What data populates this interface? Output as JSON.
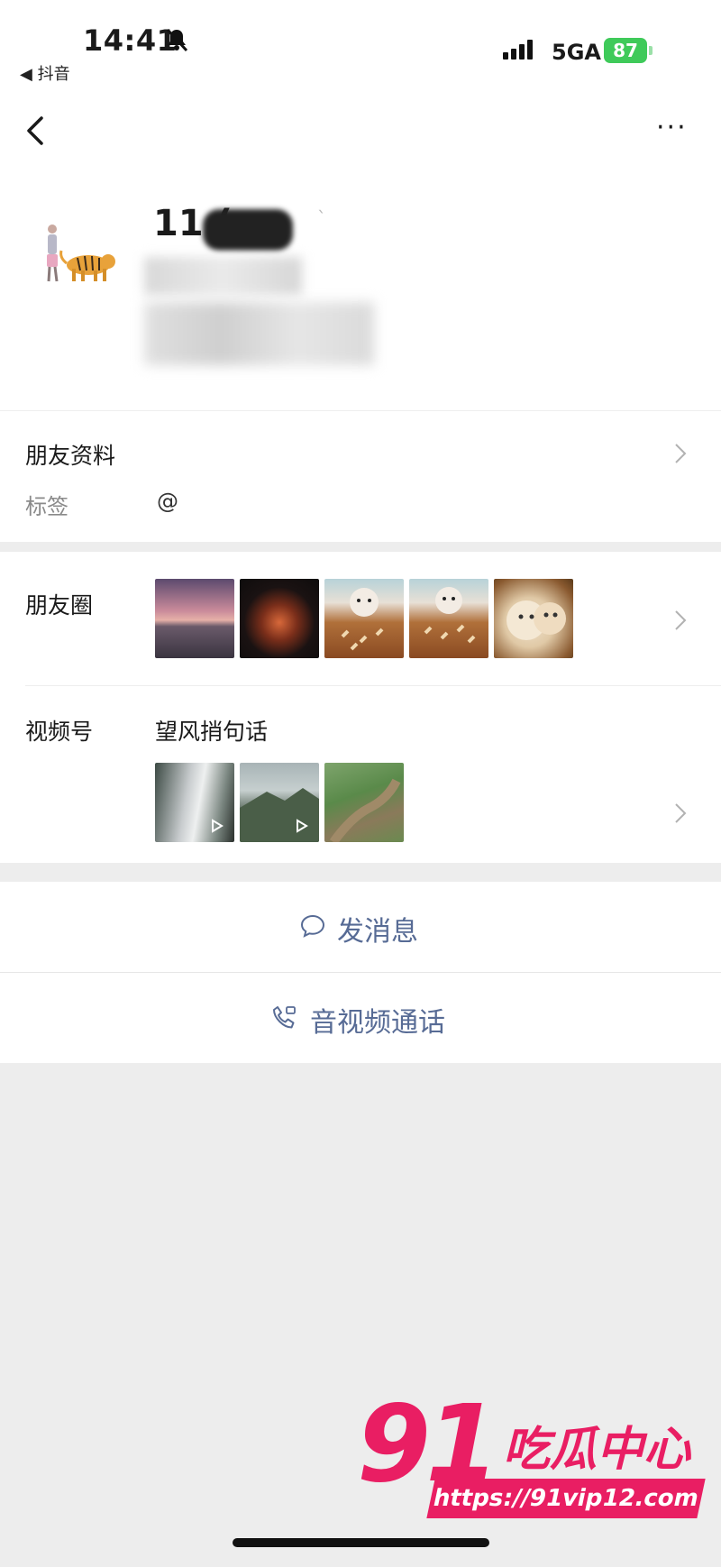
{
  "status_bar": {
    "time": "14:41",
    "back_app": "◀ 抖音",
    "network": "5GA",
    "battery": "87"
  },
  "nav": {
    "more_label": "···"
  },
  "profile": {
    "name_prefix": "11 (",
    "name_suffix": "`"
  },
  "info": {
    "friend_info_label": "朋友资料",
    "tags_label": "标签",
    "tags_value": "@"
  },
  "moments": {
    "label": "朋友圈",
    "thumbnails": [
      "sunset-lake-photo",
      "dark-room-photo",
      "puppy-treats-photo",
      "puppy-treats-photo-2",
      "puppy-closeup-photo"
    ]
  },
  "channels": {
    "label": "视频号",
    "channel_name": "望风捎句话",
    "thumbnails": [
      "waterfall-video",
      "mountain-video",
      "hillside-trail-video"
    ]
  },
  "actions": {
    "message_label": "发消息",
    "call_label": "音视频通话"
  },
  "watermark": {
    "number": "91",
    "text": "吃瓜中心",
    "url": "https://91vip12.com"
  },
  "colors": {
    "link": "#576b95",
    "battery": "#3fca5a",
    "watermark": "#e91e63",
    "background": "#ededed"
  }
}
